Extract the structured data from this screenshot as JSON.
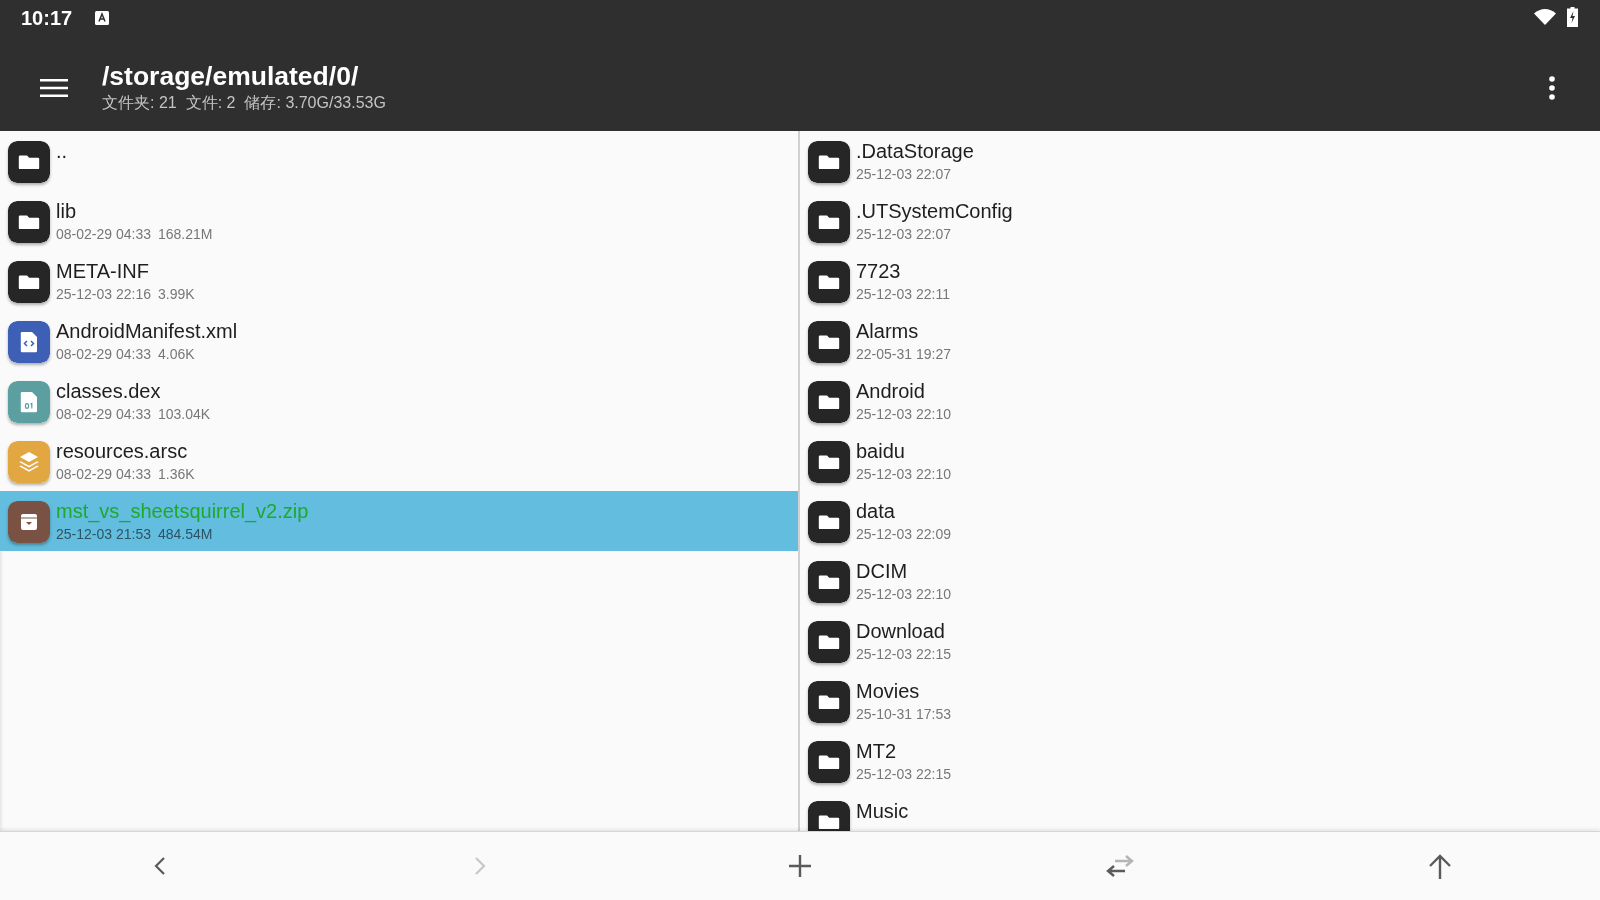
{
  "status_bar": {
    "time": "10:17"
  },
  "toolbar": {
    "title": "/storage/emulated/0/",
    "stats": [
      "文件夹: 21",
      "文件: 2",
      "储存: 3.70G/33.53G"
    ]
  },
  "left_panel": {
    "items": [
      {
        "kind": "folder",
        "name": "..",
        "selected": false
      },
      {
        "kind": "folder",
        "name": "lib",
        "date": "08-02-29 04:33",
        "size": "168.21M",
        "selected": false
      },
      {
        "kind": "folder",
        "name": "META-INF",
        "date": "25-12-03 22:16",
        "size": "3.99K",
        "selected": false
      },
      {
        "kind": "xml",
        "name": "AndroidManifest.xml",
        "date": "08-02-29 04:33",
        "size": "4.06K",
        "selected": false
      },
      {
        "kind": "dex",
        "name": "classes.dex",
        "date": "08-02-29 04:33",
        "size": "103.04K",
        "selected": false
      },
      {
        "kind": "resources",
        "name": "resources.arsc",
        "date": "08-02-29 04:33",
        "size": "1.36K",
        "selected": false
      },
      {
        "kind": "archive",
        "name": "mst_vs_sheetsquirrel_v2.zip",
        "date": "25-12-03 21:53",
        "size": "484.54M",
        "selected": true
      }
    ]
  },
  "right_panel": {
    "items": [
      {
        "kind": "folder",
        "name": ".DataStorage",
        "date": "25-12-03 22:07",
        "selected": false
      },
      {
        "kind": "folder",
        "name": ".UTSystemConfig",
        "date": "25-12-03 22:07",
        "selected": false
      },
      {
        "kind": "folder",
        "name": "7723",
        "date": "25-12-03 22:11",
        "selected": false
      },
      {
        "kind": "folder",
        "name": "Alarms",
        "date": "22-05-31 19:27",
        "selected": false
      },
      {
        "kind": "folder",
        "name": "Android",
        "date": "25-12-03 22:10",
        "selected": false
      },
      {
        "kind": "folder",
        "name": "baidu",
        "date": "25-12-03 22:10",
        "selected": false
      },
      {
        "kind": "folder",
        "name": "data",
        "date": "25-12-03 22:09",
        "selected": false
      },
      {
        "kind": "folder",
        "name": "DCIM",
        "date": "25-12-03 22:10",
        "selected": false
      },
      {
        "kind": "folder",
        "name": "Download",
        "date": "25-12-03 22:15",
        "selected": false
      },
      {
        "kind": "folder",
        "name": "Movies",
        "date": "25-10-31 17:53",
        "selected": false
      },
      {
        "kind": "folder",
        "name": "MT2",
        "date": "25-12-03 22:15",
        "selected": false
      },
      {
        "kind": "folder",
        "name": "Music",
        "selected": false
      }
    ]
  },
  "bottom_bar": {
    "buttons": [
      {
        "kind": "back",
        "disabled": false
      },
      {
        "kind": "forward",
        "disabled": true
      },
      {
        "kind": "add",
        "disabled": false
      },
      {
        "kind": "swap",
        "disabled": false
      },
      {
        "kind": "up",
        "disabled": false
      }
    ]
  }
}
